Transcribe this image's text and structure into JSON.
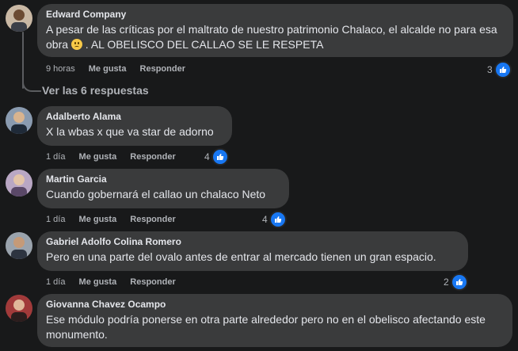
{
  "thread": {
    "view_replies": "Ver las 6 respuestas"
  },
  "comments": [
    {
      "author": "Edward Company",
      "text_before_emoji": "A pesar de las críticas por el maltrato de nuestro patrimonio Chalaco, el alcalde no para esa obra",
      "emoji": "confused-face",
      "text_after_emoji": " . AL OBELISCO DEL CALLAO SE LE RESPETA",
      "time": "9 horas",
      "like_label": "Me gusta",
      "reply_label": "Responder",
      "reactions": "3"
    },
    {
      "author": "Adalberto Alama",
      "text": "X la wbas x que va star de adorno",
      "time": "1 día",
      "like_label": "Me gusta",
      "reply_label": "Responder",
      "reactions": "4"
    },
    {
      "author": "Martin Garcia",
      "text": "Cuando gobernará el callao un chalaco Neto",
      "time": "1 día",
      "like_label": "Me gusta",
      "reply_label": "Responder",
      "reactions": "4"
    },
    {
      "author": "Gabriel Adolfo Colina Romero",
      "text": "Pero en una parte del ovalo antes de entrar al mercado tienen un gran espacio.",
      "time": "1 día",
      "like_label": "Me gusta",
      "reply_label": "Responder",
      "reactions": "2"
    },
    {
      "author": "Giovanna Chavez Ocampo",
      "text": "Ese módulo podría ponerse en otra parte alrededor pero no en el obelisco afectando este monumento."
    }
  ],
  "colors": {
    "background": "#18191a",
    "bubble": "#3a3b3c",
    "like_blue": "#1877f2",
    "muted_text": "#b0b3b8"
  }
}
